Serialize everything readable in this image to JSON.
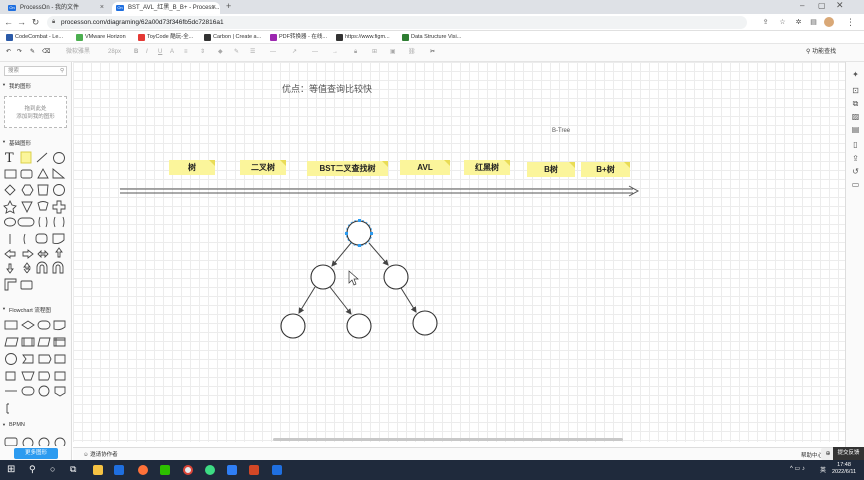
{
  "browser": {
    "tabs": [
      {
        "label": "ProcessOn - 我的文件",
        "favicon": "On"
      },
      {
        "label": "BST_AVL_红黑_B_B+ - Process...",
        "favicon": "On"
      }
    ],
    "new_tab": "+",
    "url": "processon.com/diagraming/62a00d73f346fb5dc72816a1",
    "bookmarks": [
      {
        "label": "CodeCombat - Le...",
        "color": "#2b5aa8"
      },
      {
        "label": "VMware Horizon",
        "color": "#4caf50"
      },
      {
        "label": "ToyCode 酷玩-全...",
        "color": "#e53935"
      },
      {
        "label": "Carbon | Create a...",
        "color": "#333333"
      },
      {
        "label": "PDF转换器 - 在线...",
        "color": "#9c27b0"
      },
      {
        "label": "https://www.figm...",
        "color": "#333333"
      },
      {
        "label": "Data Structure Visi...",
        "color": "#2e7d32"
      }
    ]
  },
  "toolbar": {
    "font": "微软雅黑",
    "size": "28px",
    "bold": "B",
    "italic": "I",
    "underline": "U",
    "fontcolor": "A",
    "right_label": "功能查找"
  },
  "left_panel": {
    "search_placeholder": "搜索",
    "my_shapes": "我的图形",
    "drop_hint_1": "拖到此处",
    "drop_hint_2": "添加到我的图形",
    "basic": "基础图形",
    "flowchart": "Flowchart 流程图",
    "bpmn": "BPMN",
    "more_shapes": "更多图形"
  },
  "canvas": {
    "title": "优点：等值查询比较快",
    "btree_label": "B-Tree",
    "notes": [
      "树",
      "二叉树",
      "BST二叉查找树",
      "AVL",
      "红黑树",
      "B树",
      "B+树"
    ]
  },
  "bottom": {
    "invite": "邀请协作者",
    "help": "帮助中心",
    "feedback": "提交反馈"
  },
  "taskbar": {
    "time": "17:48",
    "date": "2022/6/11",
    "ime": "英"
  },
  "colors": {
    "note_fill": "#fbf59b",
    "selection": "#2c9bf0",
    "taskbar": "#1f2a3c"
  }
}
